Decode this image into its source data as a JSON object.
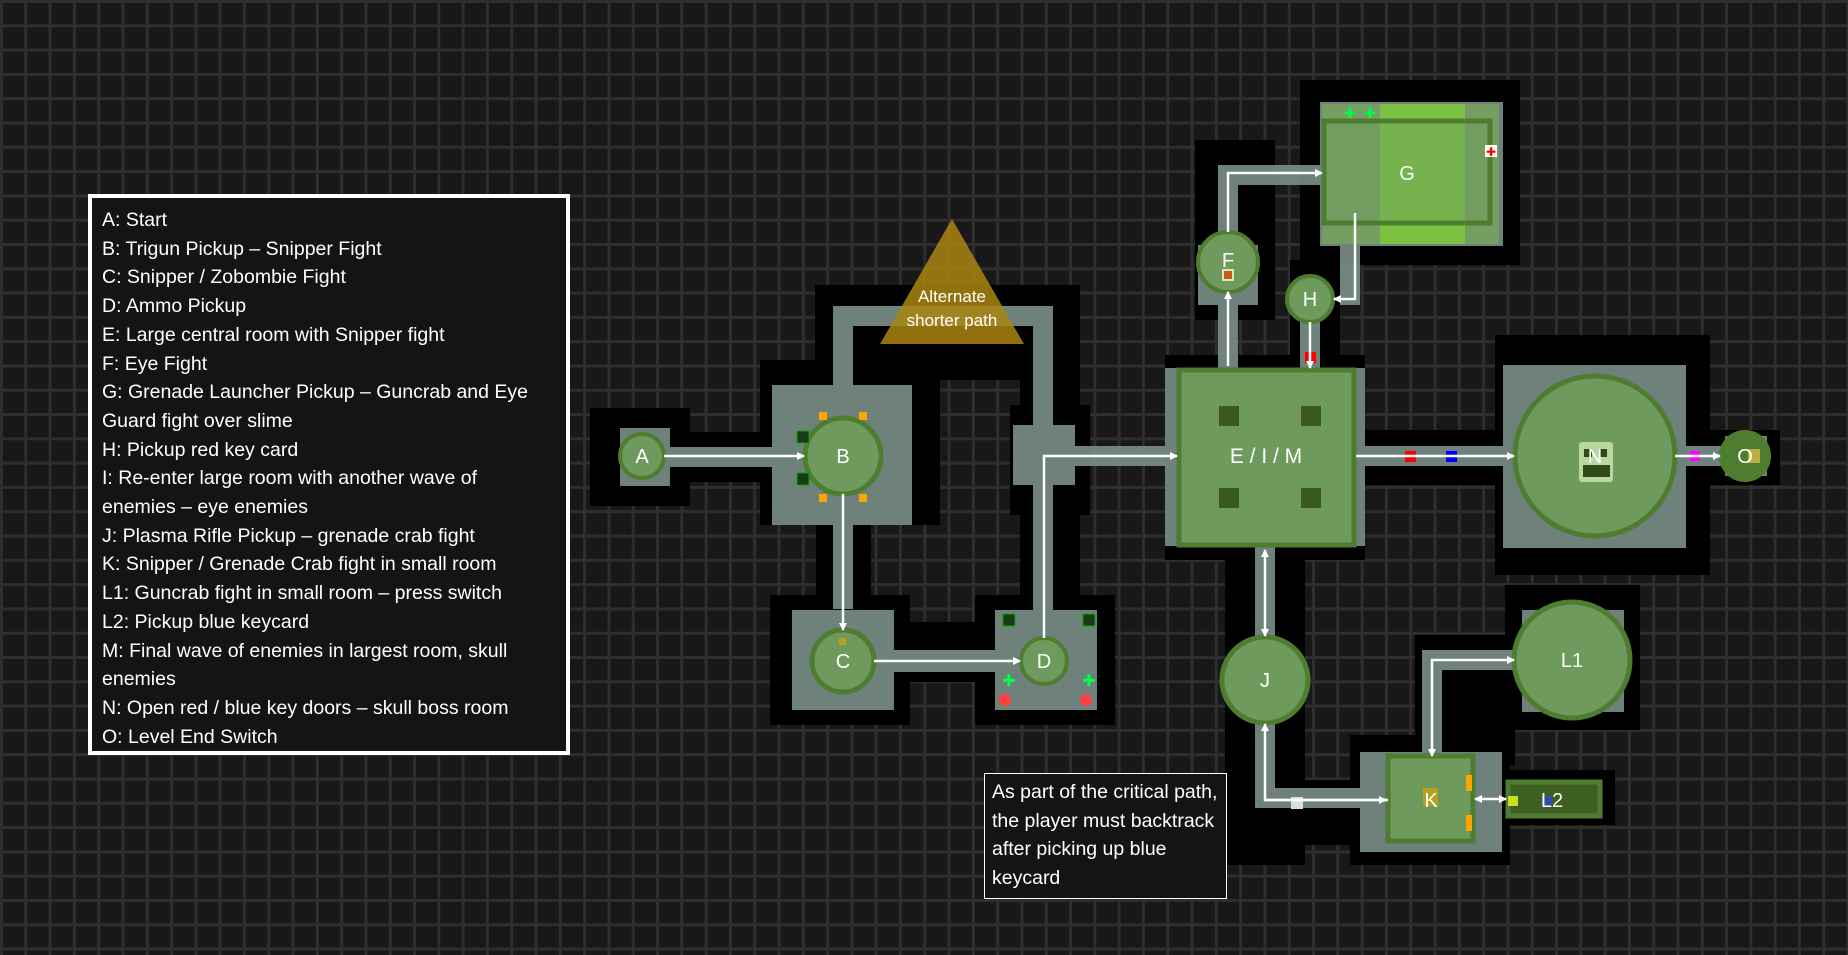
{
  "legend": {
    "entries": [
      "A: Start",
      "B: Trigun Pickup – Snipper Fight",
      "C: Snipper / Zobombie Fight",
      "D: Ammo Pickup",
      "E: Large central room with Snipper fight",
      "F: Eye Fight",
      "G: Grenade Launcher Pickup – Guncrab and Eye Guard fight over slime",
      "H: Pickup red key card",
      "I: Re-enter large room with another wave of enemies – eye enemies",
      "J: Plasma Rifle Pickup – grenade crab fight",
      "K: Snipper / Grenade Crab fight in small room",
      "L1: Guncrab fight in small room – press switch",
      "L2: Pickup blue keycard",
      "M: Final wave of enemies in largest room, skull enemies",
      "N: Open red / blue key doors – skull boss room",
      "O: Level End Switch"
    ]
  },
  "annotations": {
    "alternate_path": [
      "Alternate",
      "shorter path"
    ],
    "backtrack_note": "As part of the critical path, the player must backtrack after picking up blue keycard"
  },
  "nodes": {
    "A": "A",
    "B": "B",
    "C": "C",
    "D": "D",
    "EIM": "E / I / M",
    "F": "F",
    "G": "G",
    "H": "H",
    "J": "J",
    "K": "K",
    "L1": "L1",
    "L2": "L2",
    "N": "N",
    "O": "O"
  },
  "colors": {
    "room_green": "#6e9a5e",
    "room_border": "#4f7d2f",
    "slime": "#7cc242",
    "floor": "#7b8f89",
    "wall": "#000000",
    "path": "#ffffff",
    "red_key_door": "#ff0000",
    "blue_key_door": "#0000ff",
    "exit_door": "#ff00ff",
    "triangle": "#a9850f"
  }
}
